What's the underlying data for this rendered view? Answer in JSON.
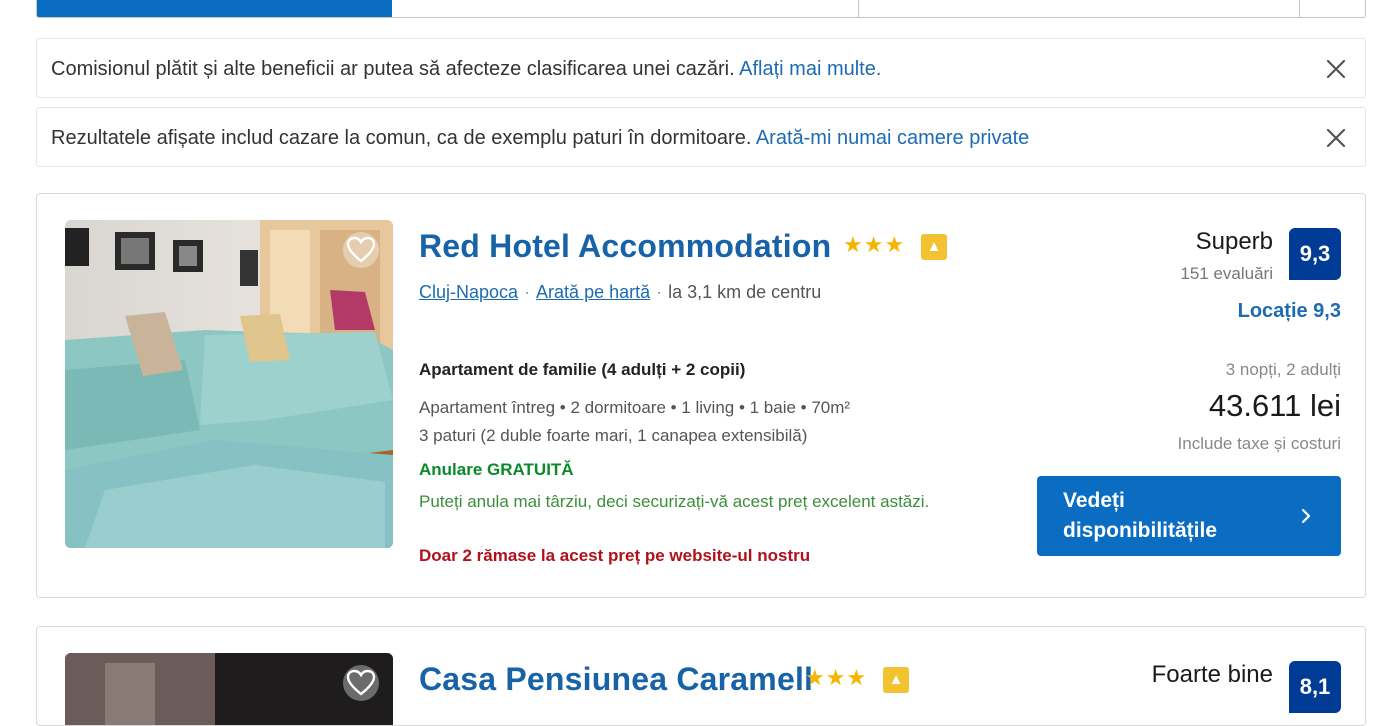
{
  "notices": [
    {
      "text": "Comisionul plătit și alte beneficii ar putea să afecteze clasificarea unei cazări. ",
      "link": "Aflați mai multe."
    },
    {
      "text": "Rezultatele afișate includ cazare la comun, ca de exemplu paturi în dormitoare. ",
      "link": "Arată-mi numai camere private"
    }
  ],
  "listings": [
    {
      "name": "Red Hotel Accommodation",
      "stars": "★★★",
      "city": "Cluj-Napoca",
      "map_link": "Arată pe hartă",
      "distance": "la 3,1 km de centru",
      "rating_word": "Superb",
      "reviews": "151 evaluări",
      "score": "9,3",
      "location_score": "Locație 9,3",
      "room_title": "Apartament de familie (4 adulți + 2 copii)",
      "room_desc": "Apartament întreg • 2 dormitoare • 1 living • 1 baie • 70m²",
      "beds": "3 paturi (2 duble foarte mari, 1 canapea extensibilă)",
      "free_cancel": "Anulare GRATUITĂ",
      "free_cancel_text": "Puteți anula mai târziu, deci securizați-vă acest preț excelent astăzi.",
      "scarcity": "Doar 2 rămase la acest preț pe website-ul nostru",
      "stay": "3 nopți, 2 adulți",
      "price": "43.611 lei",
      "taxes": "Include taxe și costuri",
      "cta": "Vedeți disponibilitățile"
    },
    {
      "name": "Casa Pensiunea Caramell",
      "stars": "★★★",
      "rating_word": "Foarte bine",
      "score": "8,1"
    }
  ],
  "colors": {
    "brand_blue": "#0a6dc2",
    "score_blue": "#003b95",
    "link_blue": "#1d6bb3",
    "green": "#0a8a2a",
    "red": "#b0121c",
    "star_yellow": "#f4b400"
  }
}
